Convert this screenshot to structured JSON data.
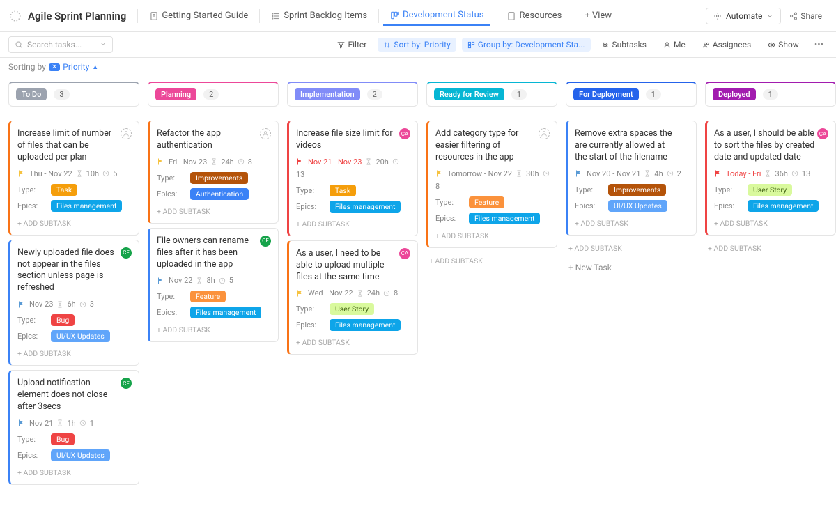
{
  "header": {
    "title": "Agile Sprint Planning",
    "tabs": [
      {
        "label": "Getting Started Guide"
      },
      {
        "label": "Sprint Backlog Items"
      },
      {
        "label": "Development Status"
      },
      {
        "label": "Resources"
      }
    ],
    "add_view": "+ View",
    "automate": "Automate",
    "share": "Share"
  },
  "subbar": {
    "search_placeholder": "Search tasks...",
    "filter": "Filter",
    "sort": "Sort by: Priority",
    "group": "Group by: Development Sta...",
    "subtasks": "Subtasks",
    "me": "Me",
    "assignees": "Assignees",
    "show": "Show"
  },
  "sortline": {
    "prefix": "Sorting by",
    "value": "Priority",
    "arrow": "▲"
  },
  "labels": {
    "type": "Type:",
    "epics": "Epics:",
    "add_subtask": "+ ADD SUBTASK",
    "new_task": "+ New Task"
  },
  "columns": [
    {
      "name": "To Do",
      "count": "3",
      "top_color": "#9ca3af",
      "pill_bg": "#9ca3af"
    },
    {
      "name": "Planning",
      "count": "2",
      "top_color": "#ec4899",
      "pill_bg": "#ec4899"
    },
    {
      "name": "Implementation",
      "count": "2",
      "top_color": "#818cf8",
      "pill_bg": "#818cf8"
    },
    {
      "name": "Ready for Review",
      "count": "1",
      "top_color": "#06b6d4",
      "pill_bg": "#06b6d4"
    },
    {
      "name": "For Deployment",
      "count": "1",
      "top_color": "#2563eb",
      "pill_bg": "#2563eb"
    },
    {
      "name": "Deployed",
      "count": "1",
      "top_color": "#a21caf",
      "pill_bg": "#a21caf"
    }
  ],
  "cards": {
    "c0_0": {
      "title": "Increase limit of number of files that can be uploaded per plan",
      "flag": "#f6c342",
      "dates": "Thu  -  Nov 22",
      "hours": "10h",
      "sub": "5",
      "type": {
        "label": "Task",
        "bg": "#f59e0b"
      },
      "epic": {
        "label": "Files management",
        "bg": "#0ea5e9"
      },
      "avatar": "dashed",
      "stripe": "#f97316"
    },
    "c0_1": {
      "title": "Newly uploaded file does not appear in the files section unless page is refreshed",
      "flag": "#5b9bd5",
      "dates": "Nov 23",
      "hours": "6h",
      "sub": "3",
      "type": {
        "label": "Bug",
        "bg": "#ef4444"
      },
      "epic": {
        "label": "UI/UX Updates",
        "bg": "#60a5fa"
      },
      "avatar": "green",
      "stripe": "#3b82f6"
    },
    "c0_2": {
      "title": "Upload notification element does not close after 3secs",
      "flag": "#5b9bd5",
      "dates": "Nov 21",
      "hours": "1h",
      "sub": "1",
      "type": {
        "label": "Bug",
        "bg": "#ef4444"
      },
      "epic": {
        "label": "UI/UX Updates",
        "bg": "#60a5fa"
      },
      "avatar": "green",
      "stripe": "#3b82f6"
    },
    "c1_0": {
      "title": "Refactor the app authentication",
      "flag": "#f6c342",
      "dates": "Fri  -  Nov 23",
      "hours": "24h",
      "sub": "8",
      "type": {
        "label": "Improvements",
        "bg": "#b45309"
      },
      "epic": {
        "label": "Authentication",
        "bg": "#3b82f6"
      },
      "avatar": "dashed",
      "stripe": "#f97316"
    },
    "c1_1": {
      "title": "File owners can rename files after it has been uploaded in the app",
      "flag": "#5b9bd5",
      "dates": "Nov 22",
      "hours": "8h",
      "sub": "5",
      "type": {
        "label": "Feature",
        "bg": "#fb923c"
      },
      "epic": {
        "label": "Files management",
        "bg": "#0ea5e9"
      },
      "avatar": "green",
      "stripe": "#3b82f6"
    },
    "c2_0": {
      "title": "Increase file size limit for videos",
      "flag": "#ef4444",
      "dates": "Nov 21  -  Nov 23",
      "hours": "20h",
      "sub": "13",
      "type": {
        "label": "Task",
        "bg": "#f59e0b"
      },
      "epic": {
        "label": "Files management",
        "bg": "#0ea5e9"
      },
      "avatar": "pink",
      "stripe": "#ef4444"
    },
    "c2_1": {
      "title": "As a user, I need to be able to upload multiple files at the same time",
      "flag": "#f6c342",
      "dates": "Wed  -  Nov 22",
      "hours": "24h",
      "sub": "8",
      "type": {
        "label": "User Story",
        "bg": "#d9f99d",
        "fg": "#3f6212"
      },
      "epic": {
        "label": "Files management",
        "bg": "#0ea5e9"
      },
      "avatar": "pink",
      "stripe": "#f97316"
    },
    "c3_0": {
      "title": "Add category type for easier filtering of resources in the app",
      "flag": "#f6c342",
      "dates": "Tomorrow  -  Nov 22",
      "hours": "30h",
      "sub": "8",
      "type": {
        "label": "Feature",
        "bg": "#fb923c"
      },
      "epic": {
        "label": "Files management",
        "bg": "#0ea5e9"
      },
      "avatar": "dashed",
      "stripe": "#f97316"
    },
    "c4_0": {
      "title": "Remove extra spaces the are currently allowed at the start of the filename",
      "flag": "#5b9bd5",
      "dates": "Nov 20 - Nov 21",
      "hours": "4h",
      "sub": "2",
      "type": {
        "label": "Improvements",
        "bg": "#b45309"
      },
      "epic": {
        "label": "UI/UX Updates",
        "bg": "#60a5fa"
      },
      "avatar": "none",
      "stripe": "#3b82f6"
    },
    "c5_0": {
      "title": "As a user, I should be able to sort the files by created date and updated date",
      "flag": "#ef4444",
      "dates": "Today  -  Fri",
      "hours": "36h",
      "sub": "13",
      "type": {
        "label": "User Story",
        "bg": "#d9f99d",
        "fg": "#3f6212"
      },
      "epic": {
        "label": "Files management",
        "bg": "#0ea5e9"
      },
      "avatar": "pink",
      "stripe": "#ef4444"
    }
  }
}
